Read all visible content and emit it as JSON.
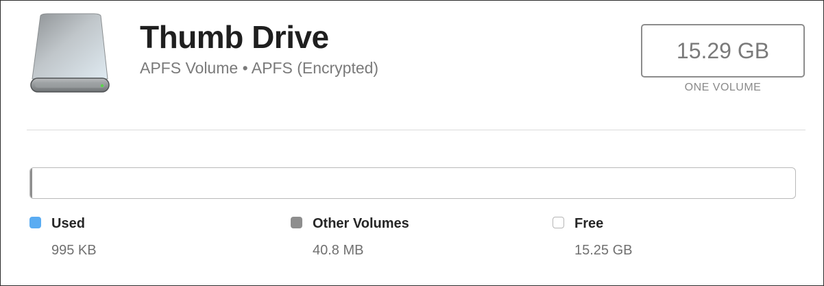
{
  "drive": {
    "icon": "external-drive-icon",
    "name": "Thumb Drive",
    "subtitle": "APFS Volume • APFS (Encrypted)"
  },
  "capacity": {
    "total": "15.29 GB",
    "caption": "ONE VOLUME"
  },
  "usage": {
    "segments": [
      {
        "key": "used",
        "label": "Used",
        "value": "995 KB",
        "color": "#5aacf2",
        "fraction": 6.5e-05
      },
      {
        "key": "other",
        "label": "Other Volumes",
        "value": "40.8 MB",
        "color": "#8e8e8e",
        "fraction": 0.0027
      },
      {
        "key": "free",
        "label": "Free",
        "value": "15.25 GB",
        "color": "#ffffff",
        "fraction": 0.9973
      }
    ]
  }
}
